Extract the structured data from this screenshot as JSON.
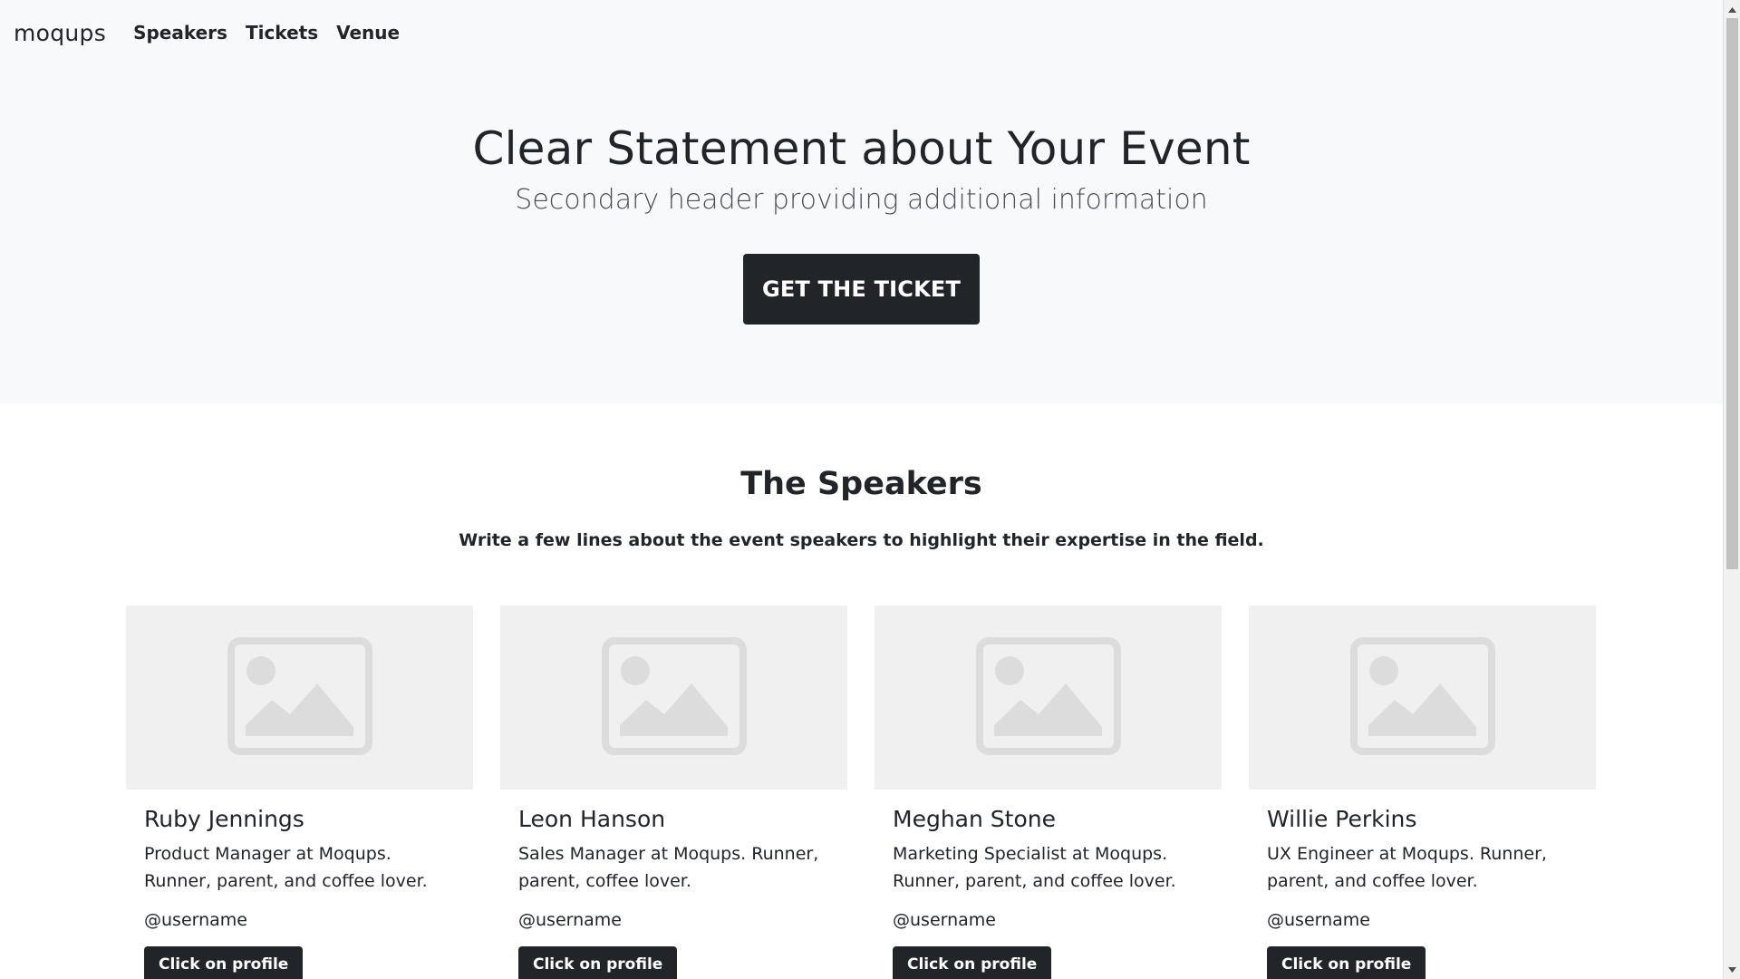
{
  "nav": {
    "brand": "moqups",
    "links": [
      "Speakers",
      "Tickets",
      "Venue"
    ]
  },
  "hero": {
    "title": "Clear Statement about Your Event",
    "subtitle": "Secondary header providing additional information",
    "cta": "GET THE TICKET"
  },
  "speakers_section": {
    "title": "The Speakers",
    "lead": "Write a few lines about the event speakers to highlight their expertise in the field.",
    "cards": [
      {
        "name": "Ruby Jennings",
        "description": "Product Manager at Moqups. Runner, parent, and coffee lover.",
        "username": "@username",
        "button": "Click on profile"
      },
      {
        "name": "Leon Hanson",
        "description": "Sales Manager at Moqups. Runner, parent, coffee lover.",
        "username": "@username",
        "button": "Click on profile"
      },
      {
        "name": "Meghan Stone",
        "description": "Marketing Specialist at Moqups. Runner, parent, and coffee lover.",
        "username": "@username",
        "button": "Click on profile"
      },
      {
        "name": "Willie Perkins",
        "description": "UX Engineer at Moqups. Runner, parent, and coffee lover.",
        "username": "@username",
        "button": "Click on profile"
      }
    ]
  },
  "icons": {
    "card_image": "image-placeholder-icon",
    "scroll_up": "triangle-up-icon",
    "scroll_down": "triangle-down-icon"
  },
  "colors": {
    "hero_bg": "#f8f9fa",
    "dark_button": "#212529",
    "text": "#212529",
    "card_image_bg": "#f0f0f0",
    "placeholder_icon": "#dcdcdc"
  }
}
